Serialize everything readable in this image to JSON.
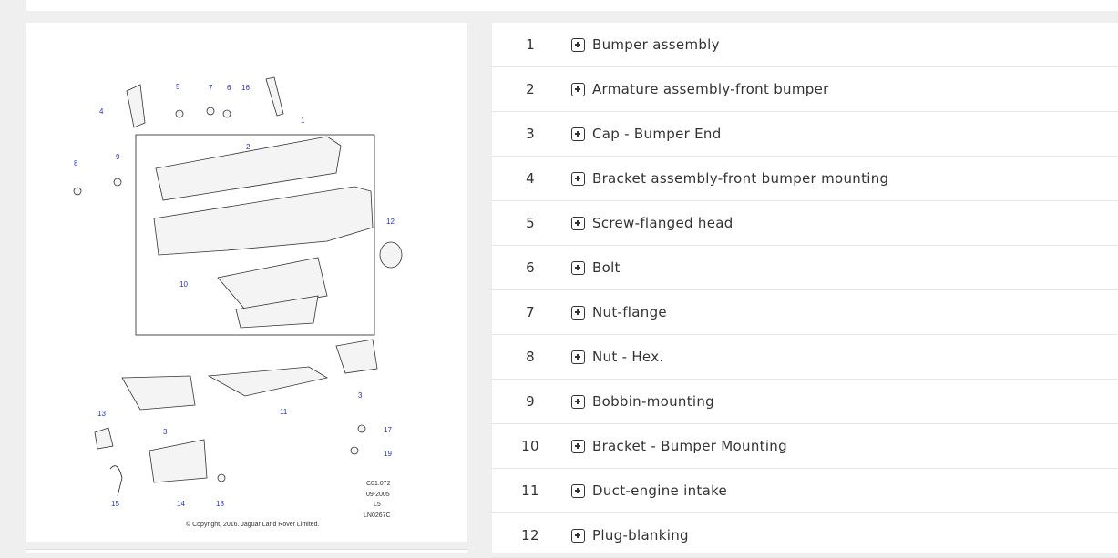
{
  "diagram": {
    "callouts": [
      "1",
      "2",
      "3",
      "4",
      "5",
      "6",
      "7",
      "8",
      "9",
      "10",
      "11",
      "12",
      "13",
      "14",
      "15",
      "16",
      "17",
      "18",
      "19"
    ],
    "meta": [
      "C01.072",
      "09-2005",
      "L5",
      "LN0267C"
    ],
    "copyright": "© Copyright, 2016. Jaguar Land Rover Limited.",
    "label_color": "#2233cc"
  },
  "parts": [
    {
      "num": "1",
      "name": "Bumper assembly",
      "icon": "plus-square-icon"
    },
    {
      "num": "2",
      "name": "Armature assembly-front bumper",
      "icon": "plus-square-icon"
    },
    {
      "num": "3",
      "name": "Cap - Bumper End",
      "icon": "plus-square-icon"
    },
    {
      "num": "4",
      "name": "Bracket assembly-front bumper mounting",
      "icon": "plus-square-icon"
    },
    {
      "num": "5",
      "name": "Screw-flanged head",
      "icon": "plus-square-icon"
    },
    {
      "num": "6",
      "name": "Bolt",
      "icon": "plus-square-icon"
    },
    {
      "num": "7",
      "name": "Nut-flange",
      "icon": "plus-square-icon"
    },
    {
      "num": "8",
      "name": "Nut - Hex.",
      "icon": "plus-square-icon"
    },
    {
      "num": "9",
      "name": "Bobbin-mounting",
      "icon": "plus-square-icon"
    },
    {
      "num": "10",
      "name": "Bracket - Bumper Mounting",
      "icon": "plus-square-icon"
    },
    {
      "num": "11",
      "name": "Duct-engine intake",
      "icon": "plus-square-icon"
    },
    {
      "num": "12",
      "name": "Plug-blanking",
      "icon": "plus-square-icon"
    }
  ]
}
